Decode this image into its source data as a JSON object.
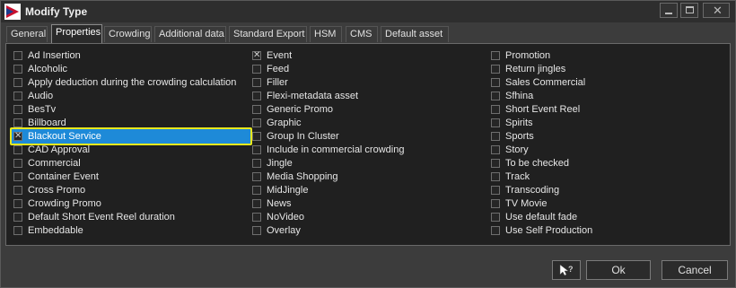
{
  "window": {
    "title": "Modify Type"
  },
  "tabs": [
    {
      "label": "General",
      "active": false
    },
    {
      "label": "Properties",
      "active": true
    },
    {
      "label": "Crowding",
      "active": false
    },
    {
      "label": "Additional data",
      "active": false
    },
    {
      "label": "Standard Export",
      "active": false
    },
    {
      "label": "HSM",
      "active": false
    },
    {
      "label": "CMS",
      "active": false
    },
    {
      "label": "Default asset",
      "active": false
    }
  ],
  "columns": [
    [
      {
        "label": "Ad Insertion",
        "checked": false
      },
      {
        "label": "Alcoholic",
        "checked": false
      },
      {
        "label": "Apply deduction during the crowding calculation",
        "checked": false
      },
      {
        "label": "Audio",
        "checked": false
      },
      {
        "label": "BesTv",
        "checked": false
      },
      {
        "label": "Billboard",
        "checked": false
      },
      {
        "label": "Blackout Service",
        "checked": true,
        "selected": true
      },
      {
        "label": "CAD Approval",
        "checked": false
      },
      {
        "label": "Commercial",
        "checked": false
      },
      {
        "label": "Container Event",
        "checked": false
      },
      {
        "label": "Cross Promo",
        "checked": false
      },
      {
        "label": "Crowding Promo",
        "checked": false
      },
      {
        "label": "Default Short Event Reel duration",
        "checked": false
      },
      {
        "label": "Embeddable",
        "checked": false
      }
    ],
    [
      {
        "label": "Event",
        "checked": true
      },
      {
        "label": "Feed",
        "checked": false
      },
      {
        "label": "Filler",
        "checked": false
      },
      {
        "label": "Flexi-metadata asset",
        "checked": false
      },
      {
        "label": "Generic Promo",
        "checked": false
      },
      {
        "label": "Graphic",
        "checked": false
      },
      {
        "label": "Group In Cluster",
        "checked": false
      },
      {
        "label": "Include in commercial crowding",
        "checked": false
      },
      {
        "label": "Jingle",
        "checked": false
      },
      {
        "label": "Media Shopping",
        "checked": false
      },
      {
        "label": "MidJingle",
        "checked": false
      },
      {
        "label": "News",
        "checked": false
      },
      {
        "label": "NoVideo",
        "checked": false
      },
      {
        "label": "Overlay",
        "checked": false
      }
    ],
    [
      {
        "label": "Promotion",
        "checked": false
      },
      {
        "label": "Return jingles",
        "checked": false
      },
      {
        "label": "Sales Commercial",
        "checked": false
      },
      {
        "label": "Sfhina",
        "checked": false
      },
      {
        "label": "Short Event Reel",
        "checked": false
      },
      {
        "label": "Spirits",
        "checked": false
      },
      {
        "label": "Sports",
        "checked": false
      },
      {
        "label": "Story",
        "checked": false
      },
      {
        "label": "To be checked",
        "checked": false
      },
      {
        "label": "Track",
        "checked": false
      },
      {
        "label": "Transcoding",
        "checked": false
      },
      {
        "label": "TV Movie",
        "checked": false
      },
      {
        "label": "Use default fade",
        "checked": false
      },
      {
        "label": "Use Self Production",
        "checked": false
      }
    ]
  ],
  "footer": {
    "help_icon": "help-pointer-icon",
    "ok_label": "Ok",
    "cancel_label": "Cancel"
  },
  "colors": {
    "selection": "#1e8ad8",
    "highlight": "#e8e81c",
    "background": "#3c3c3c"
  }
}
